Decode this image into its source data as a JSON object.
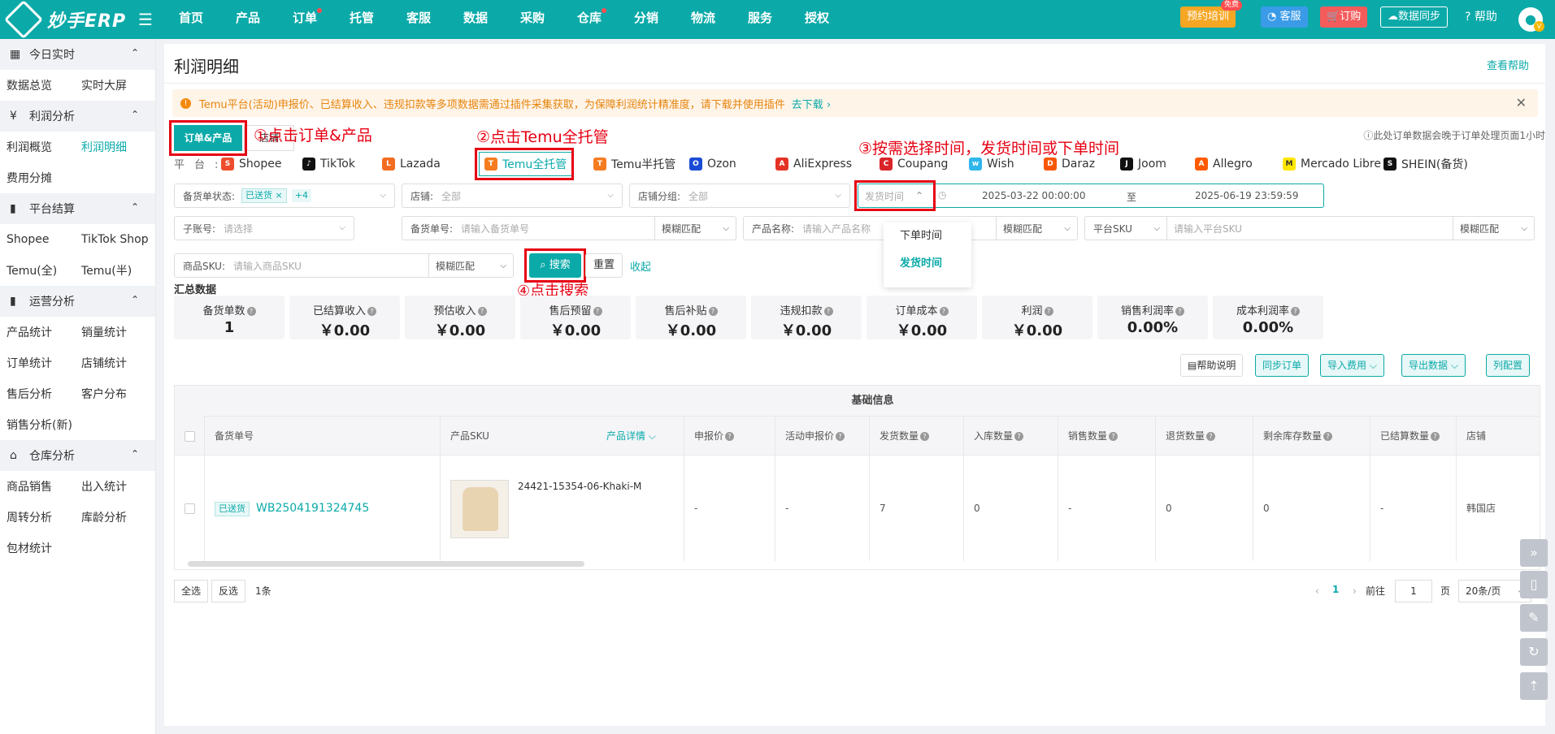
{
  "brand": {
    "name": "妙手ERP"
  },
  "nav": [
    {
      "label": "首页",
      "dot": false
    },
    {
      "label": "产品",
      "dot": false
    },
    {
      "label": "订单",
      "dot": true
    },
    {
      "label": "托管",
      "dot": false
    },
    {
      "label": "客服",
      "dot": false
    },
    {
      "label": "数据",
      "dot": false
    },
    {
      "label": "采购",
      "dot": false
    },
    {
      "label": "仓库",
      "dot": true
    },
    {
      "label": "分销",
      "dot": false
    },
    {
      "label": "物流",
      "dot": false
    },
    {
      "label": "服务",
      "dot": false
    },
    {
      "label": "授权",
      "dot": false
    }
  ],
  "topright": {
    "training": "预约培训",
    "free": "免费",
    "service": "客服",
    "order": "订购",
    "sync": "数据同步",
    "help": "帮助",
    "avatar_badge": "V"
  },
  "sidebar": {
    "groups": [
      {
        "title": "今日实时",
        "icon": "calendar-icon",
        "items": [
          "数据总览",
          "实时大屏"
        ]
      },
      {
        "title": "利润分析",
        "icon": "yen-icon",
        "items": [
          "利润概览",
          "利润明细",
          "费用分摊"
        ]
      },
      {
        "title": "平台结算",
        "icon": "bar-chart-icon",
        "items": [
          "Shopee",
          "TikTok Shop",
          "Temu(全)",
          "Temu(半)"
        ]
      },
      {
        "title": "运营分析",
        "icon": "bar-chart-icon",
        "items": [
          "产品统计",
          "销量统计",
          "订单统计",
          "店铺统计",
          "售后分析",
          "客户分布",
          "销售分析(新)"
        ]
      },
      {
        "title": "仓库分析",
        "icon": "warehouse-icon",
        "items": [
          "商品销售",
          "出入统计",
          "周转分析",
          "库龄分析",
          "包材统计"
        ]
      }
    ],
    "active": "利润明细"
  },
  "page": {
    "title": "利润明细",
    "view_help": "查看帮助"
  },
  "notice": {
    "text": "Temu平台(活动)申报价、已结算收入、违规扣款等多项数据需通过插件采集获取，为保障利润统计精准度，请下载并使用插件",
    "link": "去下载"
  },
  "tabs": {
    "order_product": "订单&产品",
    "shop": "店铺"
  },
  "annotations": {
    "a1": "①点击订单&产品",
    "a2": "②点击Temu全托管",
    "a3": "③按需选择时间，发货时间或下单时间",
    "a4": "④点击搜索"
  },
  "note_right": "此处订单数据会晚于订单处理页面1小时",
  "platforms": {
    "label": "平台:",
    "items": [
      {
        "name": "Shopee",
        "color": "#ee4d2d",
        "glyph": "S"
      },
      {
        "name": "TikTok",
        "color": "#111111",
        "glyph": "♪"
      },
      {
        "name": "Lazada",
        "color": "#f36d21",
        "glyph": "L"
      },
      {
        "name": "Temu全托管",
        "color": "#f57c20",
        "glyph": "T"
      },
      {
        "name": "Temu半托管",
        "color": "#f57c20",
        "glyph": "T"
      },
      {
        "name": "Ozon",
        "color": "#1a4bd6",
        "glyph": "O"
      },
      {
        "name": "AliExpress",
        "color": "#e43225",
        "glyph": "A"
      },
      {
        "name": "Coupang",
        "color": "#d9252a",
        "glyph": "C"
      },
      {
        "name": "Wish",
        "color": "#2fb7ec",
        "glyph": "w"
      },
      {
        "name": "Daraz",
        "color": "#f85606",
        "glyph": "D"
      },
      {
        "name": "Joom",
        "color": "#111111",
        "glyph": "J"
      },
      {
        "name": "Allegro",
        "color": "#ff5a00",
        "glyph": "A"
      },
      {
        "name": "Mercado Libre",
        "color": "#ffe600",
        "glyph": "M"
      },
      {
        "name": "SHEIN(备货)",
        "color": "#111111",
        "glyph": "S"
      }
    ],
    "active": "Temu全托管"
  },
  "filters": {
    "stock_status": {
      "label": "备货单状态:",
      "tag": "已送货",
      "more": "+4"
    },
    "shop": {
      "label": "店铺:",
      "value": "全部"
    },
    "shop_group": {
      "label": "店铺分组:",
      "value": "全部"
    },
    "time_type": {
      "value": "发货时间"
    },
    "date_start": "2025-03-22 00:00:00",
    "date_sep": "至",
    "date_end": "2025-06-19 23:59:59",
    "sub_account": {
      "label": "子账号:",
      "placeholder": "请选择"
    },
    "stock_no": {
      "label": "备货单号:",
      "placeholder": "请输入备货单号",
      "match": "模糊匹配"
    },
    "product_name": {
      "label": "产品名称:",
      "placeholder": "请输入产品名称",
      "match": "模糊匹配"
    },
    "platform_sku": {
      "label": "平台SKU",
      "placeholder": "请输入平台SKU",
      "match": "模糊匹配"
    },
    "goods_sku": {
      "label": "商品SKU:",
      "placeholder": "请输入商品SKU",
      "match": "模糊匹配"
    }
  },
  "time_dropdown": [
    "下单时间",
    "发货时间"
  ],
  "actions": {
    "search": "搜索",
    "reset": "重置",
    "collapse": "收起"
  },
  "summary": {
    "title": "汇总数据",
    "stats": [
      {
        "label": "备货单数",
        "value": "1"
      },
      {
        "label": "已结算收入",
        "value": "￥0.00"
      },
      {
        "label": "预估收入",
        "value": "￥0.00"
      },
      {
        "label": "售后预留",
        "value": "￥0.00"
      },
      {
        "label": "售后补贴",
        "value": "￥0.00"
      },
      {
        "label": "违规扣款",
        "value": "￥0.00"
      },
      {
        "label": "订单成本",
        "value": "￥0.00"
      },
      {
        "label": "利润",
        "value": "￥0.00"
      },
      {
        "label": "销售利润率",
        "value": "0.00%"
      },
      {
        "label": "成本利润率",
        "value": "0.00%"
      }
    ]
  },
  "toolbar": {
    "help": "帮助说明",
    "sync": "同步订单",
    "import": "导入费用",
    "export": "导出数据",
    "columns": "列配置"
  },
  "table": {
    "group_header": "基础信息",
    "headers": [
      "备货单号",
      "产品SKU",
      "产品详情",
      "申报价",
      "活动申报价",
      "发货数量",
      "入库数量",
      "销售数量",
      "退货数量",
      "剩余库存数量",
      "已结算数量",
      "店铺"
    ],
    "row": {
      "status": "已送货",
      "order_no": "WB2504191324745",
      "sku": "24421-15354-06-Khaki-M",
      "declared": "-",
      "activity": "-",
      "shipped": "7",
      "inbound": "0",
      "sold": "-",
      "returned": "0",
      "stock": "0",
      "settled": "-",
      "shop": "韩国店"
    }
  },
  "footer": {
    "select_all": "全选",
    "invert": "反选",
    "count": "1条",
    "page": "1",
    "goto": "前往",
    "goto_value": "1",
    "page_unit": "页",
    "page_size": "20条/页"
  }
}
